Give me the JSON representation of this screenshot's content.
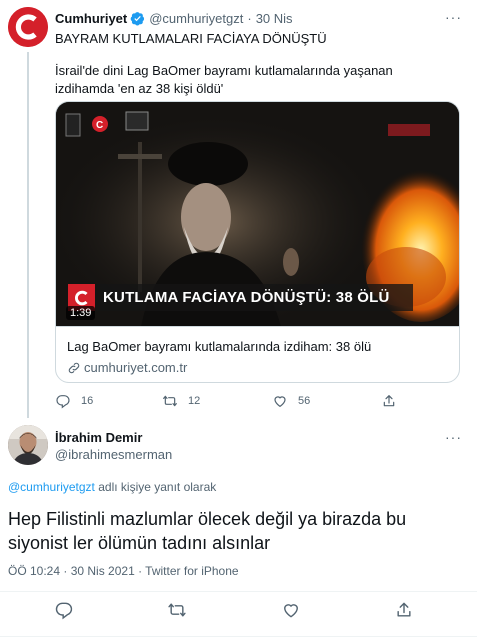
{
  "quoted_tweet": {
    "display_name": "Cumhuriyet",
    "handle": "@cumhuriyetgzt",
    "separator": "·",
    "date": "30 Nis",
    "headline": "BAYRAM KUTLAMALARI FACİAYA DÖNÜŞTÜ",
    "body": "İsrail'de dini Lag BaOmer bayramı kutlamalarında yaşanan izdihamda 'en az 38 kişi öldü'",
    "card": {
      "video_banner": "KUTLAMA FACİAYA DÖNÜŞTÜ: 38 ÖLÜ",
      "video_logo_letter": "C",
      "duration": "1:39",
      "title": "Lag BaOmer bayramı kutlamalarında izdiham: 38 ölü",
      "domain": "cumhuriyet.com.tr"
    },
    "stats": {
      "replies": "16",
      "retweets": "12",
      "likes": "56"
    },
    "colors": {
      "brand": "#d4202a",
      "verified": "#1d9bf0"
    },
    "icons": [
      "verified-badge-icon",
      "reply-icon",
      "retweet-icon",
      "like-icon",
      "share-icon",
      "link-icon"
    ]
  },
  "reply_tweet": {
    "display_name": "İbrahim Demir",
    "handle": "@ibrahimesmerman",
    "replying_to_handle": "@cumhuriyetgzt",
    "replying_to_suffix": " adlı kişiye yanıt olarak",
    "text": "Hep Filistinli mazlumlar ölecek değil ya  birazda bu siyonist ler ölümün tadını alsınlar",
    "meta": "ÖÖ 10:24 · 30 Nis 2021 · Twitter for iPhone",
    "icons": [
      "reply-icon",
      "retweet-icon",
      "like-icon",
      "share-icon"
    ]
  },
  "more_label": "···"
}
